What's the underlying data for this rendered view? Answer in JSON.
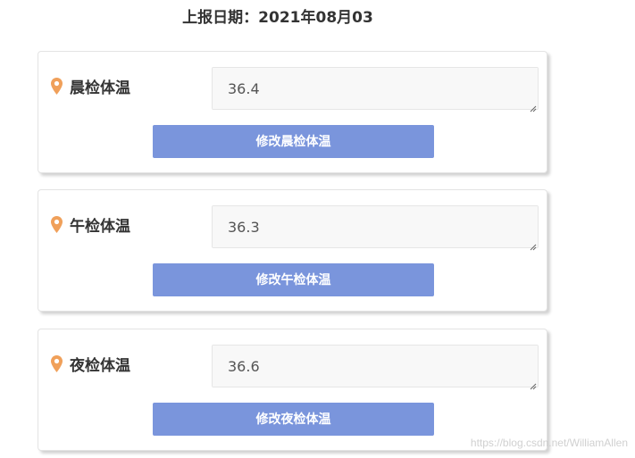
{
  "header": {
    "report_date": "上报日期：2021年08月03"
  },
  "colors": {
    "pin": "#f0a05a",
    "button": "#7a95dc"
  },
  "cards": [
    {
      "label": "晨检体温",
      "value": "36.4",
      "button_label": "修改晨检体温",
      "icon": "location-pin-icon"
    },
    {
      "label": "午检体温",
      "value": "36.3",
      "button_label": "修改午检体温",
      "icon": "location-pin-icon"
    },
    {
      "label": "夜检体温",
      "value": "36.6",
      "button_label": "修改夜检体温",
      "icon": "location-pin-icon"
    }
  ],
  "watermark": "https://blog.csdn.net/WilliamAllen"
}
